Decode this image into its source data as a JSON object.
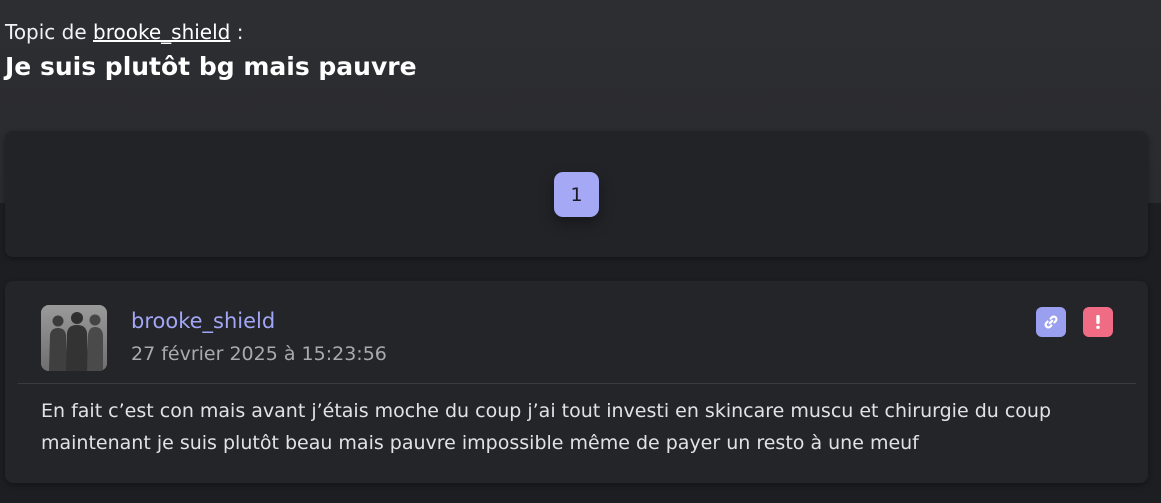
{
  "header": {
    "topic_prefix": "Topic de",
    "topic_author": "brooke_shield",
    "topic_suffix": ":",
    "title": "Je suis plutôt bg mais pauvre"
  },
  "pagination": {
    "current_page": "1"
  },
  "post": {
    "author": "brooke_shield",
    "date": "27 février 2025 à 15:23:56",
    "content": "En fait c’est con mais avant j’étais moche du coup j’ai tout investi en skincare muscu et chirurgie du coup maintenant je suis plutôt beau mais pauvre impossible même de payer un resto à une meuf"
  },
  "icons": {
    "link": "link-icon",
    "report": "exclamation-icon"
  },
  "colors": {
    "accent": "#a5a8f5",
    "report": "#f06b84",
    "background": "#1d1e21",
    "card": "#242529"
  }
}
